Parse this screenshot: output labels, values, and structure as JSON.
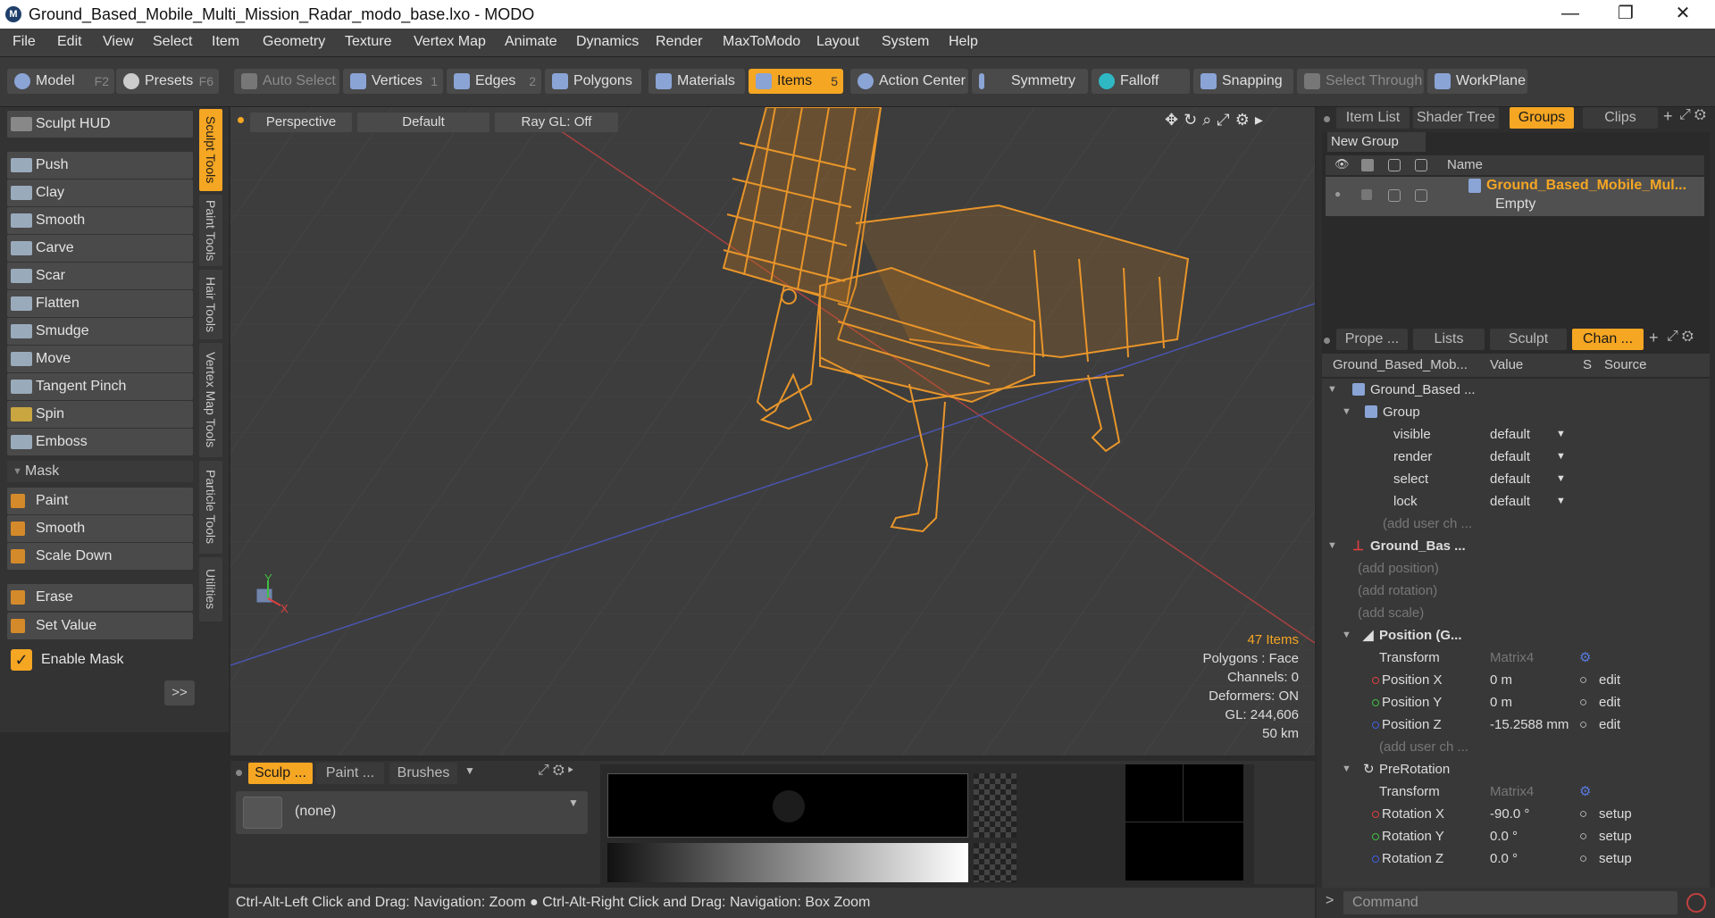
{
  "window": {
    "title": "Ground_Based_Mobile_Multi_Mission_Radar_modo_base.lxo - MODO",
    "minimize": "—",
    "restore": "❐",
    "close": "✕"
  },
  "menu": [
    "File",
    "Edit",
    "View",
    "Select",
    "Item",
    "Geometry",
    "Texture",
    "Vertex Map",
    "Animate",
    "Dynamics",
    "Render",
    "MaxToModo",
    "Layout",
    "System",
    "Help"
  ],
  "toolbar": {
    "model": "Model",
    "model_key": "F2",
    "presets": "Presets",
    "presets_key": "F6",
    "auto_select": "Auto Select",
    "vertices": "Vertices",
    "vertices_key": "1",
    "edges": "Edges",
    "edges_key": "2",
    "polygons": "Polygons",
    "materials": "Materials",
    "items": "Items",
    "items_key": "5",
    "action_center": "Action Center",
    "symmetry": "Symmetry",
    "falloff": "Falloff",
    "snapping": "Snapping",
    "select_through": "Select Through",
    "workplane": "WorkPlane"
  },
  "left": {
    "sculpt_hud": "Sculpt HUD",
    "tools": [
      "Push",
      "Clay",
      "Smooth",
      "Carve",
      "Scar",
      "Flatten",
      "Smudge",
      "Move",
      "Tangent Pinch",
      "Spin",
      "Emboss"
    ],
    "mask_header": "Mask",
    "mask_tools": [
      "Paint",
      "Smooth",
      "Scale Down"
    ],
    "erase": "Erase",
    "set_value": "Set Value",
    "enable_mask": "Enable Mask",
    "more": ">>",
    "vtabs": [
      "Sculpt Tools",
      "Paint Tools",
      "Hair Tools",
      "Vertex Map Tools",
      "Particle Tools",
      "Utilities"
    ]
  },
  "viewport": {
    "view": "Perspective",
    "style": "Default",
    "raygl": "Ray GL: Off",
    "stats": {
      "items": "47 Items",
      "polygons": "Polygons : Face",
      "channels": "Channels: 0",
      "deformers": "Deformers: ON",
      "gl": "GL: 244,606",
      "scale": "50 km"
    },
    "axis_y": "Y",
    "axis_x": "X"
  },
  "right": {
    "top_tabs": [
      "Item List",
      "Shader Tree",
      "Groups",
      "Clips"
    ],
    "new_group": "New Group",
    "name_header": "Name",
    "group_name": "Ground_Based_Mobile_Mul...",
    "group_sub": "Empty",
    "mid_tabs": [
      "Prope ...",
      "Lists",
      "Sculpt",
      "Chan ..."
    ],
    "chan_headers": {
      "name": "Ground_Based_Mob...",
      "value": "Value",
      "s": "S",
      "source": "Source"
    },
    "rows": [
      {
        "name": "Ground_Based ...",
        "value": "",
        "source": ""
      },
      {
        "name": "Group",
        "value": "",
        "source": ""
      },
      {
        "name": "visible",
        "value": "default",
        "source": ""
      },
      {
        "name": "render",
        "value": "default",
        "source": ""
      },
      {
        "name": "select",
        "value": "default",
        "source": ""
      },
      {
        "name": "lock",
        "value": "default",
        "source": ""
      },
      {
        "name": "(add user ch ...",
        "value": "",
        "source": ""
      },
      {
        "name": "Ground_Bas ...",
        "value": "",
        "source": ""
      },
      {
        "name": "(add position)",
        "value": "",
        "source": ""
      },
      {
        "name": "(add rotation)",
        "value": "",
        "source": ""
      },
      {
        "name": "(add scale)",
        "value": "",
        "source": ""
      },
      {
        "name": "Position (G...",
        "value": "",
        "source": ""
      },
      {
        "name": "Transform",
        "value": "Matrix4",
        "source": ""
      },
      {
        "name": "Position X",
        "value": "0 m",
        "source": "edit"
      },
      {
        "name": "Position Y",
        "value": "0 m",
        "source": "edit"
      },
      {
        "name": "Position Z",
        "value": "-15.2588 mm",
        "source": "edit"
      },
      {
        "name": "(add user ch ...",
        "value": "",
        "source": ""
      },
      {
        "name": "PreRotation",
        "value": "",
        "source": ""
      },
      {
        "name": "Transform",
        "value": "Matrix4",
        "source": ""
      },
      {
        "name": "Rotation X",
        "value": "-90.0 °",
        "source": "setup"
      },
      {
        "name": "Rotation Y",
        "value": "0.0 °",
        "source": "setup"
      },
      {
        "name": "Rotation Z",
        "value": "0.0 °",
        "source": "setup"
      }
    ]
  },
  "bottom": {
    "tabs": [
      "Sculp ...",
      "Paint ...",
      "Brushes"
    ],
    "brush": "(none)"
  },
  "status": "Ctrl-Alt-Left Click and Drag: Navigation: Zoom ● Ctrl-Alt-Right Click and Drag: Navigation: Box Zoom",
  "command": "Command",
  "colors": {
    "accent": "#f5a623",
    "x": "#e04040",
    "y": "#40c040",
    "z": "#4060e0"
  }
}
